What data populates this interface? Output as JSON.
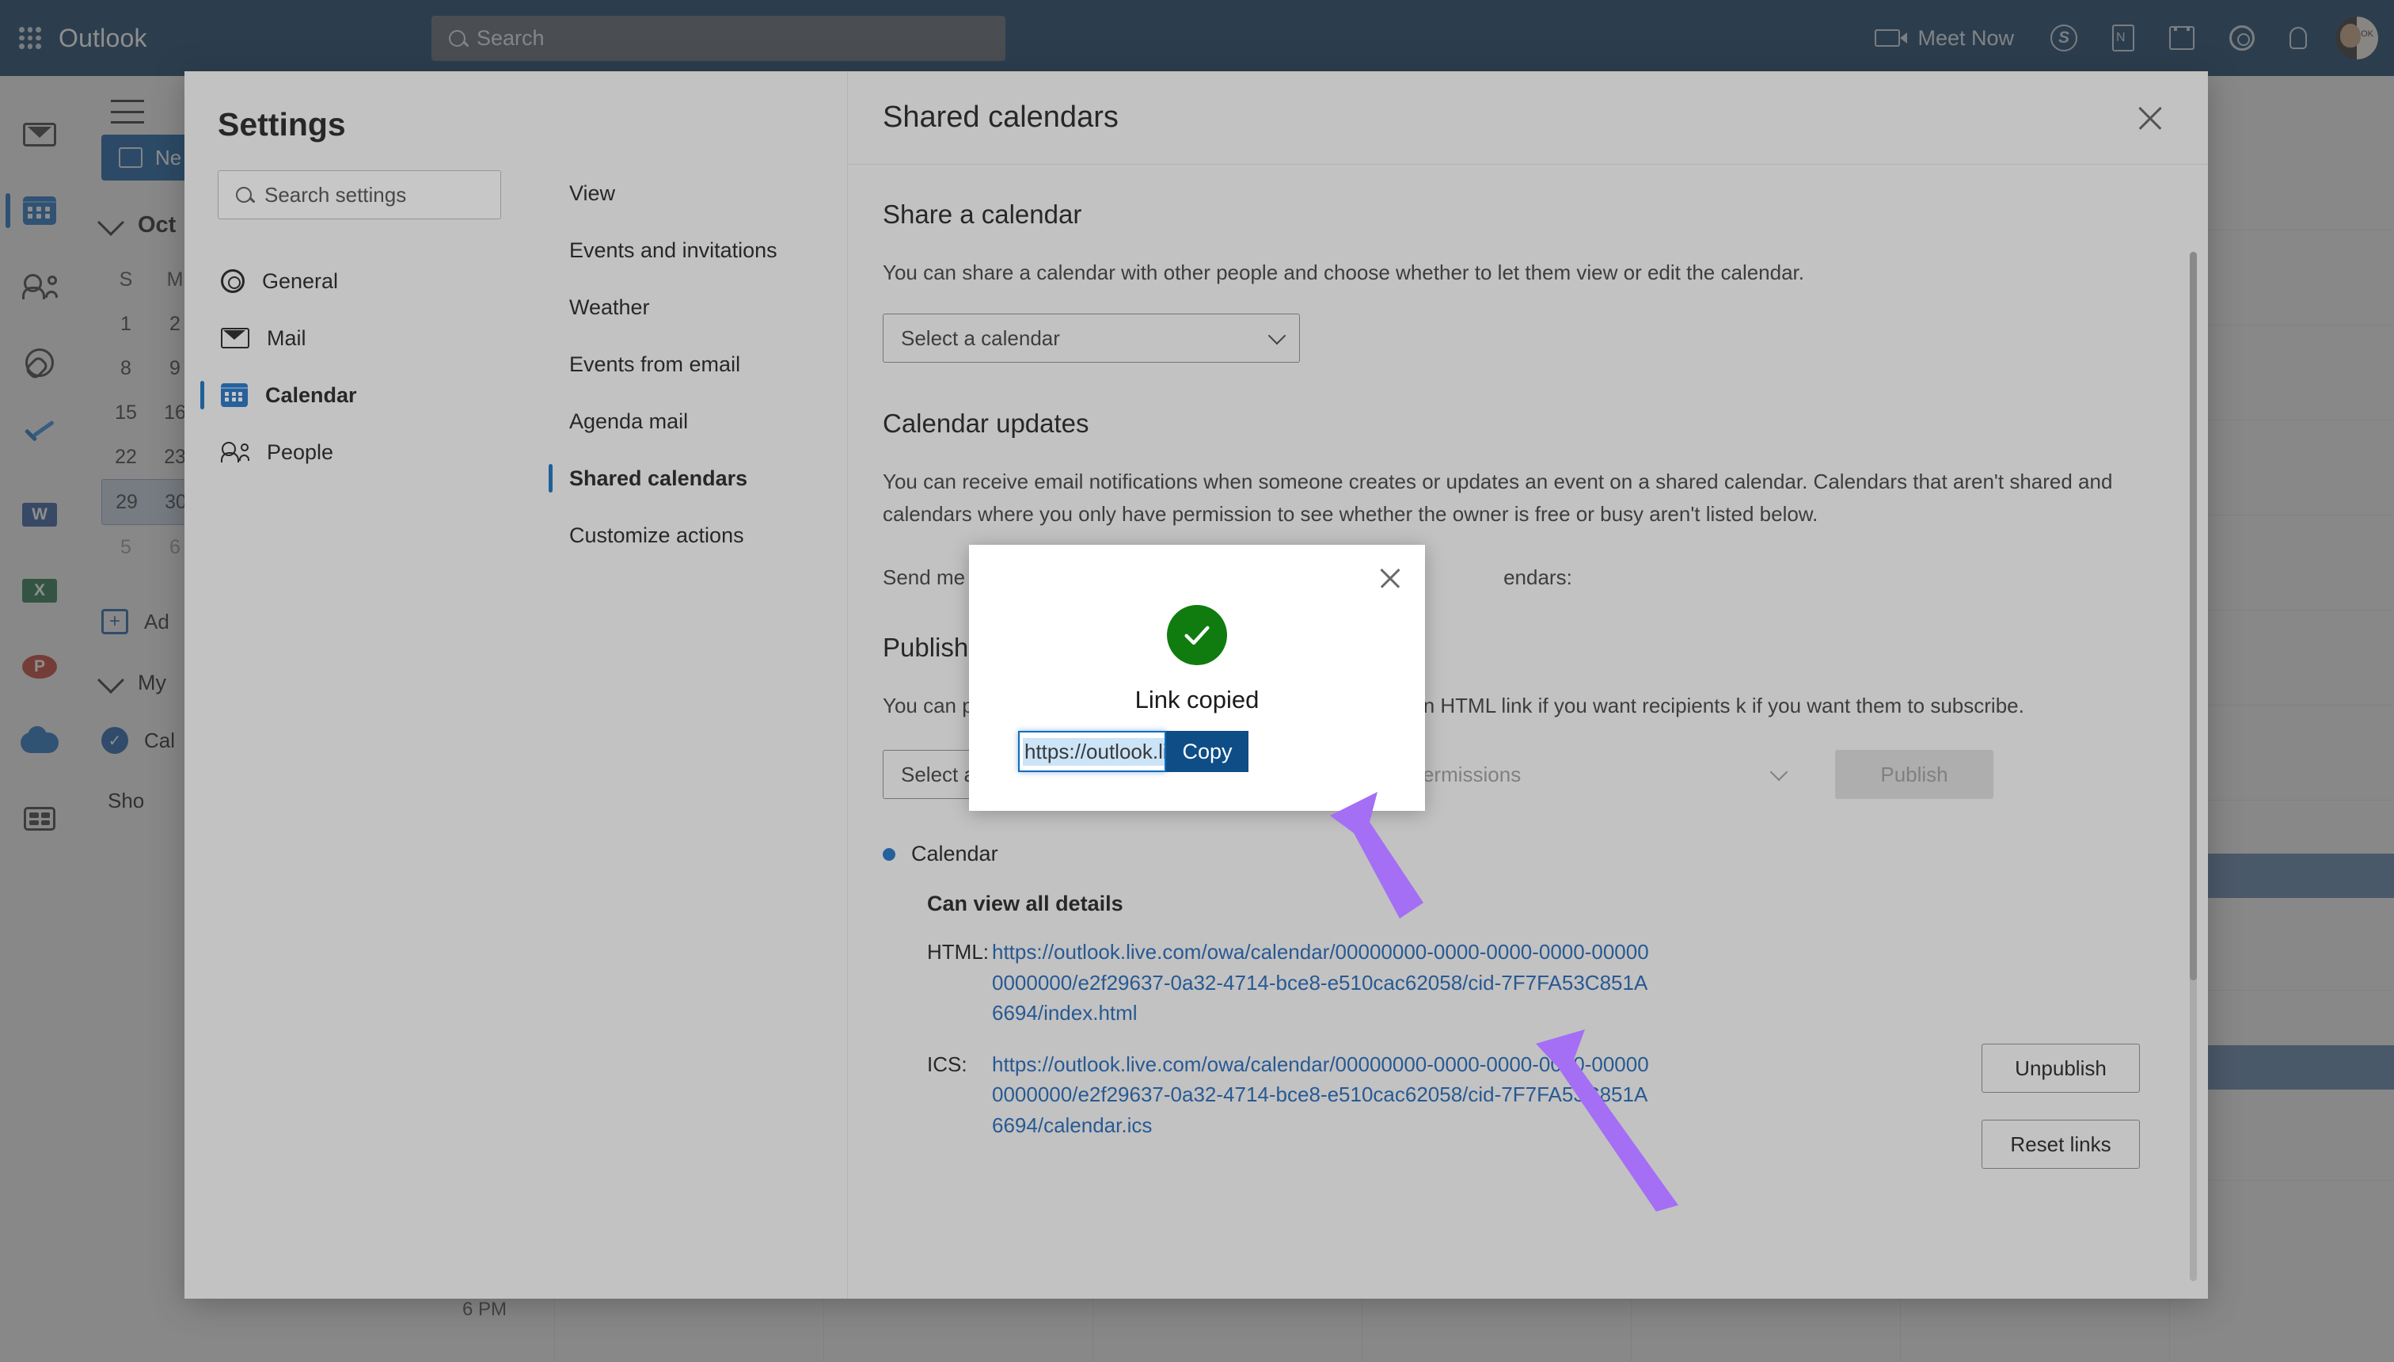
{
  "topbar": {
    "waffle_icon": "grid-icon",
    "brand": "Outlook",
    "search_placeholder": "Search",
    "meet_now": "Meet Now",
    "icons": [
      "camera-icon",
      "skype-icon",
      "onenote-icon",
      "todo-icon",
      "gear-icon",
      "lightbulb-icon",
      "avatar"
    ],
    "skype_glyph": "S",
    "onenote_glyph": "N",
    "avatar_glyph": "OK",
    "bg_color": "#0f3b63"
  },
  "rail": {
    "items": [
      {
        "name": "mail-icon",
        "selected": false
      },
      {
        "name": "calendar-icon",
        "selected": true
      },
      {
        "name": "people-icon",
        "selected": false
      },
      {
        "name": "files-icon",
        "selected": false
      },
      {
        "name": "todo-icon",
        "selected": false
      },
      {
        "name": "word-icon",
        "glyph": "W",
        "selected": false
      },
      {
        "name": "excel-icon",
        "glyph": "X",
        "selected": false
      },
      {
        "name": "powerpoint-icon",
        "glyph": "P",
        "selected": false
      },
      {
        "name": "onedrive-icon",
        "selected": false
      },
      {
        "name": "apps-icon",
        "selected": false
      }
    ]
  },
  "leftpanel": {
    "new_event_label": "Ne",
    "month": "Oct",
    "weekday_headers": [
      "S",
      "M"
    ],
    "weeks": [
      {
        "days": [
          "1",
          "2"
        ],
        "selected": false,
        "dim": false
      },
      {
        "days": [
          "8",
          "9"
        ],
        "selected": false,
        "dim": false
      },
      {
        "days": [
          "15",
          "16"
        ],
        "selected": false,
        "dim": false
      },
      {
        "days": [
          "22",
          "23"
        ],
        "selected": false,
        "dim": false
      },
      {
        "days": [
          "29",
          "30"
        ],
        "selected": true,
        "dim": false
      },
      {
        "days": [
          "5",
          "6"
        ],
        "selected": false,
        "dim": true
      }
    ],
    "add_calendar": "Ad",
    "my_calendars": "My",
    "calendar_item": "Cal",
    "show_item": "Sho",
    "time_label": "6 PM"
  },
  "settings": {
    "title": "Settings",
    "search_placeholder": "Search settings",
    "categories": [
      {
        "label": "General",
        "icon": "gear-icon",
        "selected": false
      },
      {
        "label": "Mail",
        "icon": "mail-icon",
        "selected": false
      },
      {
        "label": "Calendar",
        "icon": "calendar-icon",
        "selected": true
      },
      {
        "label": "People",
        "icon": "people-icon",
        "selected": false
      }
    ],
    "subnav": [
      {
        "label": "View",
        "selected": false
      },
      {
        "label": "Events and invitations",
        "selected": false
      },
      {
        "label": "Weather",
        "selected": false
      },
      {
        "label": "Events from email",
        "selected": false
      },
      {
        "label": "Agenda mail",
        "selected": false
      },
      {
        "label": "Shared calendars",
        "selected": true
      },
      {
        "label": "Customize actions",
        "selected": false
      }
    ],
    "panel": {
      "title": "Shared calendars",
      "close_icon": "close-icon",
      "share_section": {
        "heading": "Share a calendar",
        "description": "You can share a calendar with other people and choose whether to let them view or edit the calendar.",
        "select_placeholder": "Select a calendar"
      },
      "updates_section": {
        "heading": "Calendar updates",
        "description": "You can receive email notifications when someone creates or updates an event on a shared calendar. Calendars that aren't shared and calendars where you only have permission to see whether the owner is free or busy aren't listed below.",
        "send_me_label": "Send me",
        "send_me_tail": "endars:"
      },
      "publish_section": {
        "heading": "Publish",
        "description": "You can p                   eople to let them view the calendar online. Use an HTML link if you want recipients                     k if you want them to subscribe.",
        "calendar_placeholder": "Select a calendar",
        "permissions_placeholder": "Select permissions",
        "publish_button": "Publish",
        "published_calendar": "Calendar",
        "permission_label": "Can view all details",
        "html_label": "HTML:",
        "html_url": "https://outlook.live.com/owa/calendar/00000000-0000-0000-0000-000000000000/e2f29637-0a32-4714-bce8-e510cac62058/cid-7F7FA53C851A6694/index.html",
        "ics_label": "ICS:",
        "ics_url": "https://outlook.live.com/owa/calendar/00000000-0000-0000-0000-000000000000/e2f29637-0a32-4714-bce8-e510cac62058/cid-7F7FA53C851A6694/calendar.ics",
        "unpublish_button": "Unpublish",
        "reset_links_button": "Reset links"
      }
    }
  },
  "modal": {
    "close_icon": "close-icon",
    "success_icon": "checkmark-icon",
    "title": "Link copied",
    "input_value": "https://outlook.live.com",
    "copy_button": "Copy",
    "accent_green": "#107c10",
    "accent_blue": "#0f4d87"
  },
  "annotations": {
    "arrow_color": "#a46ef5",
    "arrows": 2
  }
}
